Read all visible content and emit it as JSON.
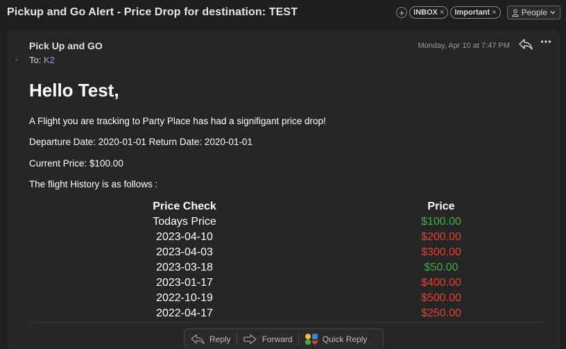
{
  "header": {
    "subject": "Pickup and Go Alert - Price Drop for destination: TEST",
    "labels": [
      {
        "name": "INBOX"
      },
      {
        "name": "Important"
      }
    ],
    "people_label": "People"
  },
  "message": {
    "from": "Pick Up and GO",
    "to_prefix": "To:",
    "to_recipient": "K2",
    "date": "Monday, Apr 10 at 7:47 PM"
  },
  "body": {
    "greeting": "Hello Test,",
    "intro": "A Flight you are tracking to Party Place has had a signifigant price drop!",
    "dates": "Departure Date: 2020-01-01 Return Date: 2020-01-01",
    "current_price": "Current Price: $100.00",
    "history_intro": "The flight History is as follows :",
    "table": {
      "headers": [
        "Price Check",
        "Price"
      ],
      "rows": [
        {
          "check": "Todays Price",
          "price": "$100.00",
          "trend": "down"
        },
        {
          "check": "2023-04-10",
          "price": "$200.00",
          "trend": "up"
        },
        {
          "check": "2023-04-03",
          "price": "$300.00",
          "trend": "up"
        },
        {
          "check": "2023-03-18",
          "price": "$50.00",
          "trend": "down"
        },
        {
          "check": "2023-01-17",
          "price": "$400.00",
          "trend": "up"
        },
        {
          "check": "2022-10-19",
          "price": "$500.00",
          "trend": "up"
        },
        {
          "check": "2022-04-17",
          "price": "$250.00",
          "trend": "up"
        }
      ]
    }
  },
  "actions": {
    "reply": "Reply",
    "forward": "Forward",
    "quick_reply": "Quick Reply"
  },
  "colors": {
    "price_down": "#3fae44",
    "price_up": "#e2402c"
  }
}
